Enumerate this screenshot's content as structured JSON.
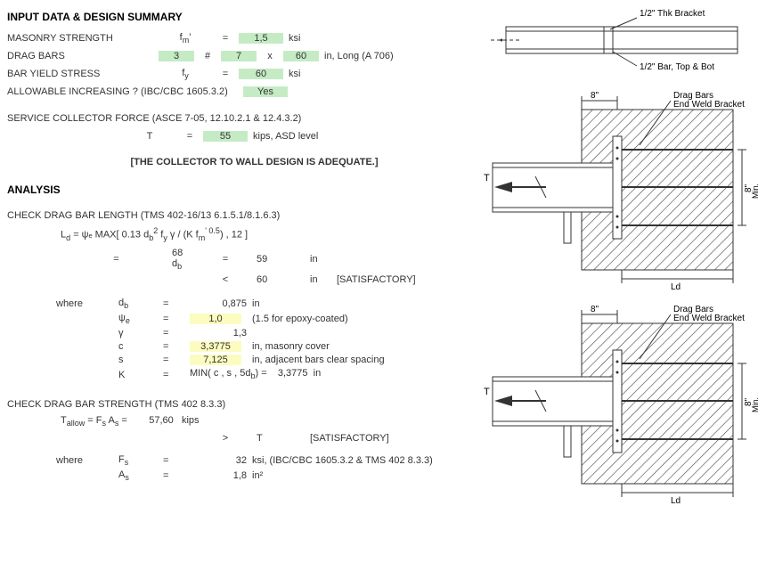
{
  "headings": {
    "input": "INPUT DATA & DESIGN SUMMARY",
    "analysis": "ANALYSIS"
  },
  "input": {
    "masonry_label": "MASONRY STRENGTH",
    "masonry_sym": "f",
    "masonry_sub": "m",
    "masonry_sup": "'",
    "masonry_val": "1,5",
    "masonry_unit": "ksi",
    "drag_label": "DRAG BARS",
    "drag_qty": "3",
    "drag_hash": "#",
    "drag_size": "7",
    "drag_x": "x",
    "drag_len": "60",
    "drag_unit": "in, Long (A 706)",
    "yield_label": "BAR YIELD STRESS",
    "yield_sym": "f",
    "yield_sub": "y",
    "yield_val": "60",
    "yield_unit": "ksi",
    "allow_label": "ALLOWABLE INCREASING ? (IBC/CBC 1605.3.2)",
    "allow_val": "Yes",
    "force_label": "SERVICE COLLECTOR FORCE (ASCE 7-05, 12.10.2.1 & 12.4.3.2)",
    "force_sym": "T",
    "force_val": "55",
    "force_unit": "kips, ASD level",
    "adequate": "[THE COLLECTOR TO WALL DESIGN IS ADEQUATE.]"
  },
  "length": {
    "title": "CHECK DRAG BAR LENGTH (TMS 402-16/13 6.1.5.1/8.1.6.3)",
    "formula_lhs": "L",
    "formula_lhs_sub": "d",
    "formula_rhs": " = ψₑ MAX[ 0.13 d",
    "formula_rhs2": " f",
    "formula_rhs3": " γ / (K f",
    "formula_rhs4": " ",
    "formula_rhs5": ") , 12 ]",
    "eq": "=",
    "coef_val": "68",
    "coef_sym": "d",
    "coef_sub": "b",
    "ld_val": "59",
    "ld_unit": "in",
    "cmp": "<",
    "cmp_val": "60",
    "cmp_unit": "in",
    "sat": "[SATISFACTORY]",
    "where": "where",
    "db_sym": "d",
    "db_sub": "b",
    "db_val": "0,875",
    "db_unit": "in",
    "psi_sym": "ψ",
    "psi_sub": "e",
    "psi_val": "1,0",
    "psi_unit": "(1.5 for epoxy-coated)",
    "gamma_sym": "γ",
    "gamma_val": "1,3",
    "c_sym": "c",
    "c_val": "3,3775",
    "c_unit": "in, masonry cover",
    "s_sym": "s",
    "s_val": "7,125",
    "s_unit": "in, adjacent bars clear spacing",
    "k_sym": "K",
    "k_expr": "MIN( c , s , 5d",
    "k_expr2": " ) =",
    "k_val": "3,3775",
    "k_unit": "in"
  },
  "strength": {
    "title": "CHECK DRAG BAR STRENGTH (TMS 402 8.3.3)",
    "lhs": "T",
    "lhs_sub": "allow",
    "rhs": " = F",
    "rhs_sub1": "s",
    "rhs2": " A",
    "rhs_sub2": "s",
    "rhs3": " =",
    "val": "57,60",
    "unit": "kips",
    "cmp": ">",
    "cmp_rhs": "T",
    "sat": "[SATISFACTORY]",
    "where": "where",
    "fs_sym": "F",
    "fs_sub": "s",
    "fs_val": "32",
    "fs_unit": "ksi, (IBC/CBC 1605.3.2 & TMS 402 8.3.3)",
    "as_sym": "A",
    "as_sub": "s",
    "as_val": "1,8",
    "as_unit": "in²"
  },
  "diagrams": {
    "d1_top": "1/2\" Thk Bracket",
    "d1_bot": "1/2\" Bar, Top & Bot",
    "d2_dim": "8\"",
    "d2_label_line1": "Drag Bars",
    "d2_label_line2": "End Weld Bracket",
    "d2_bot": "Ld",
    "d2_right1": "8\"",
    "d2_right2": "Min.",
    "T": "T"
  }
}
